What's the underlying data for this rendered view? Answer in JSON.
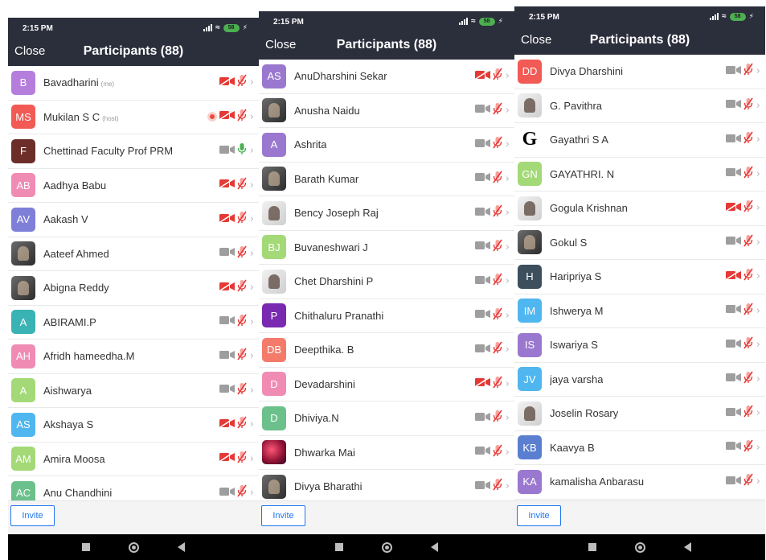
{
  "colors": {
    "header": "#2b2e3b",
    "accent": "#1e74f2",
    "muted_red": "#e53935",
    "mic_green": "#4caf50"
  },
  "screens": [
    {
      "status": {
        "time": "2:15 PM",
        "battery": "58"
      },
      "header": {
        "close_label": "Close",
        "title": "Participants (88)"
      },
      "footer": {
        "invite_label": "Invite"
      },
      "participants": [
        {
          "name": "Bavadharini",
          "role": "(me)",
          "initials": "B",
          "color": "#b57edc",
          "video": "off",
          "mic": "muted"
        },
        {
          "name": "Mukilan S C",
          "role": "(host)",
          "initials": "MS",
          "color": "#f25a55",
          "video": "off",
          "mic": "muted",
          "recording": true
        },
        {
          "name": "Chettinad Faculty Prof PRM",
          "role": "",
          "initials": "F",
          "color": "#6d2e2a",
          "video": "on",
          "mic": "on"
        },
        {
          "name": "Aadhya Babu",
          "role": "",
          "initials": "AB",
          "color": "#f08bb4",
          "video": "off",
          "mic": "muted"
        },
        {
          "name": "Aakash V",
          "role": "",
          "initials": "AV",
          "color": "#7d7fd8",
          "video": "off",
          "mic": "muted"
        },
        {
          "name": "Aateef Ahmed",
          "role": "",
          "initials": "",
          "color": "",
          "photo": true,
          "video": "on",
          "mic": "muted"
        },
        {
          "name": "Abigna Reddy",
          "role": "",
          "initials": "",
          "color": "",
          "photo": true,
          "video": "off",
          "mic": "muted"
        },
        {
          "name": "ABIRAMI.P",
          "role": "",
          "initials": "A",
          "color": "#39b3b3",
          "video": "on",
          "mic": "muted"
        },
        {
          "name": "Afridh hameedha.M",
          "role": "",
          "initials": "AH",
          "color": "#f08bb4",
          "video": "on",
          "mic": "muted"
        },
        {
          "name": "Aishwarya",
          "role": "",
          "initials": "A",
          "color": "#a3d977",
          "video": "on",
          "mic": "muted"
        },
        {
          "name": "Akshaya S",
          "role": "",
          "initials": "AS",
          "color": "#4fb6ef",
          "video": "off",
          "mic": "muted"
        },
        {
          "name": "Amira Moosa",
          "role": "",
          "initials": "AM",
          "color": "#a3d977",
          "video": "off",
          "mic": "muted"
        },
        {
          "name": "Anu Chandhini",
          "role": "",
          "initials": "AC",
          "color": "#6cc08b",
          "video": "on",
          "mic": "muted"
        }
      ]
    },
    {
      "status": {
        "time": "2:15 PM",
        "battery": "58"
      },
      "header": {
        "close_label": "Close",
        "title": "Participants (88)"
      },
      "footer": {
        "invite_label": "Invite"
      },
      "participants": [
        {
          "name": "AnuDharshini Sekar",
          "role": "",
          "initials": "AS",
          "color": "#9a78cf",
          "video": "off",
          "mic": "muted"
        },
        {
          "name": "Anusha Naidu",
          "role": "",
          "initials": "",
          "color": "",
          "photo": true,
          "video": "on",
          "mic": "muted"
        },
        {
          "name": "Ashrita",
          "role": "",
          "initials": "A",
          "color": "#9a78cf",
          "video": "on",
          "mic": "muted"
        },
        {
          "name": "Barath Kumar",
          "role": "",
          "initials": "",
          "color": "",
          "photo": true,
          "video": "on",
          "mic": "muted"
        },
        {
          "name": "Bency Joseph Raj",
          "role": "",
          "initials": "",
          "color": "",
          "photo2": true,
          "video": "on",
          "mic": "muted"
        },
        {
          "name": "Buvaneshwari J",
          "role": "",
          "initials": "BJ",
          "color": "#a3d977",
          "video": "on",
          "mic": "muted"
        },
        {
          "name": "Chet Dharshini P",
          "role": "",
          "initials": "",
          "color": "",
          "photo2": true,
          "video": "on",
          "mic": "muted"
        },
        {
          "name": "Chithaluru Pranathi",
          "role": "",
          "initials": "P",
          "color": "#7a2ab0",
          "video": "on",
          "mic": "muted"
        },
        {
          "name": "Deepthika. B",
          "role": "",
          "initials": "DB",
          "color": "#f47a6a",
          "video": "on",
          "mic": "muted"
        },
        {
          "name": "Devadarshini",
          "role": "",
          "initials": "D",
          "color": "#f08bb4",
          "video": "off",
          "mic": "muted"
        },
        {
          "name": "Dhiviya.N",
          "role": "",
          "initials": "D",
          "color": "#6cc08b",
          "video": "on",
          "mic": "muted"
        },
        {
          "name": "Dhwarka Mai",
          "role": "",
          "initials": "",
          "color": "",
          "sphere": true,
          "video": "on",
          "mic": "muted"
        },
        {
          "name": "Divya Bharathi",
          "role": "",
          "initials": "",
          "color": "",
          "photo": true,
          "video": "on",
          "mic": "muted"
        }
      ]
    },
    {
      "status": {
        "time": "2:15 PM",
        "battery": "58"
      },
      "header": {
        "close_label": "Close",
        "title": "Participants (88)"
      },
      "footer": {
        "invite_label": "Invite"
      },
      "participants": [
        {
          "name": "Divya Dharshini",
          "role": "",
          "initials": "DD",
          "color": "#f25a55",
          "video": "on",
          "mic": "muted"
        },
        {
          "name": "G. Pavithra",
          "role": "",
          "initials": "",
          "color": "",
          "photo2": true,
          "video": "on",
          "mic": "muted"
        },
        {
          "name": "Gayathri S A",
          "role": "",
          "initials": "G",
          "color": "",
          "letter_g": true,
          "video": "on",
          "mic": "muted"
        },
        {
          "name": "GAYATHRI. N",
          "role": "",
          "initials": "GN",
          "color": "#a3d977",
          "video": "on",
          "mic": "muted"
        },
        {
          "name": "Gogula Krishnan",
          "role": "",
          "initials": "",
          "color": "",
          "photo2": true,
          "video": "off",
          "mic": "muted"
        },
        {
          "name": "Gokul S",
          "role": "",
          "initials": "",
          "color": "",
          "photo": true,
          "video": "on",
          "mic": "muted"
        },
        {
          "name": "Haripriya S",
          "role": "",
          "initials": "H",
          "color": "#3d4e5c",
          "video": "off",
          "mic": "muted"
        },
        {
          "name": "Ishwerya M",
          "role": "",
          "initials": "IM",
          "color": "#4fb6ef",
          "video": "on",
          "mic": "muted"
        },
        {
          "name": "Iswariya S",
          "role": "",
          "initials": "IS",
          "color": "#9a78cf",
          "video": "on",
          "mic": "muted"
        },
        {
          "name": "jaya varsha",
          "role": "",
          "initials": "JV",
          "color": "#4fb6ef",
          "video": "on",
          "mic": "muted"
        },
        {
          "name": "Joselin Rosary",
          "role": "",
          "initials": "",
          "color": "",
          "photo2": true,
          "video": "on",
          "mic": "muted"
        },
        {
          "name": "Kaavya B",
          "role": "",
          "initials": "KB",
          "color": "#5a7fd0",
          "video": "on",
          "mic": "muted"
        },
        {
          "name": "kamalisha Anbarasu",
          "role": "",
          "initials": "KA",
          "color": "#9a78cf",
          "video": "on",
          "mic": "muted"
        }
      ]
    }
  ]
}
